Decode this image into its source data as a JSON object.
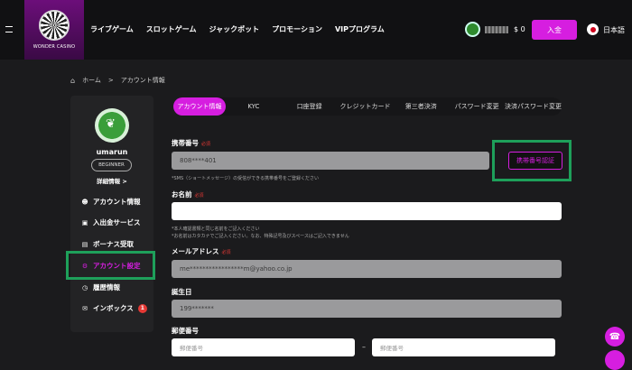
{
  "header": {
    "logo_text": "WONDER CASINO",
    "nav": [
      "ライブゲーム",
      "スロットゲーム",
      "ジャックポット",
      "プロモーション",
      "VIPプログラム"
    ],
    "balance": "$ 0",
    "deposit_label": "入金",
    "language": "日本語"
  },
  "breadcrumb": {
    "home": "ホーム",
    "separator": ">",
    "current": "アカウント情報"
  },
  "sidebar": {
    "username": "umarun",
    "level": "BEGINNER",
    "detail_link": "詳細情報 >",
    "items": [
      {
        "label": "アカウント情報",
        "icon": "user-icon"
      },
      {
        "label": "入出金サービス",
        "icon": "wallet-icon"
      },
      {
        "label": "ボーナス受取",
        "icon": "gift-icon"
      },
      {
        "label": "アカウント設定",
        "icon": "settings-icon"
      },
      {
        "label": "履歴情報",
        "icon": "history-icon"
      },
      {
        "label": "インボックス",
        "icon": "mail-icon",
        "badge": "1"
      }
    ]
  },
  "tabs": [
    "アカウント情報",
    "KYC",
    "口座登録",
    "クレジットカード",
    "第三者決済",
    "パスワード変更",
    "決済パスワード変更"
  ],
  "form": {
    "required": "必須",
    "phone": {
      "label": "携帯番号",
      "value": "808****401",
      "verify_label": "携帯番号認証",
      "note": "*SMS（ショートメッセージ）の受信ができる携帯番号をご登録ください"
    },
    "name": {
      "label": "お名前",
      "value": "",
      "note1": "*本人確認書類と同じ名前をご記入ください",
      "note2": "*お名前はカタカナでご記入ください。なお、特殊記号及びスペースはご記入できません"
    },
    "email": {
      "label": "メールアドレス",
      "value": "me*****************m@yahoo.co.jp"
    },
    "birthday": {
      "label": "誕生日",
      "value": "199*******"
    },
    "zip": {
      "label": "郵便番号",
      "placeholder1": "郵便番号",
      "placeholder2": "郵便番号",
      "separator": "–"
    }
  }
}
